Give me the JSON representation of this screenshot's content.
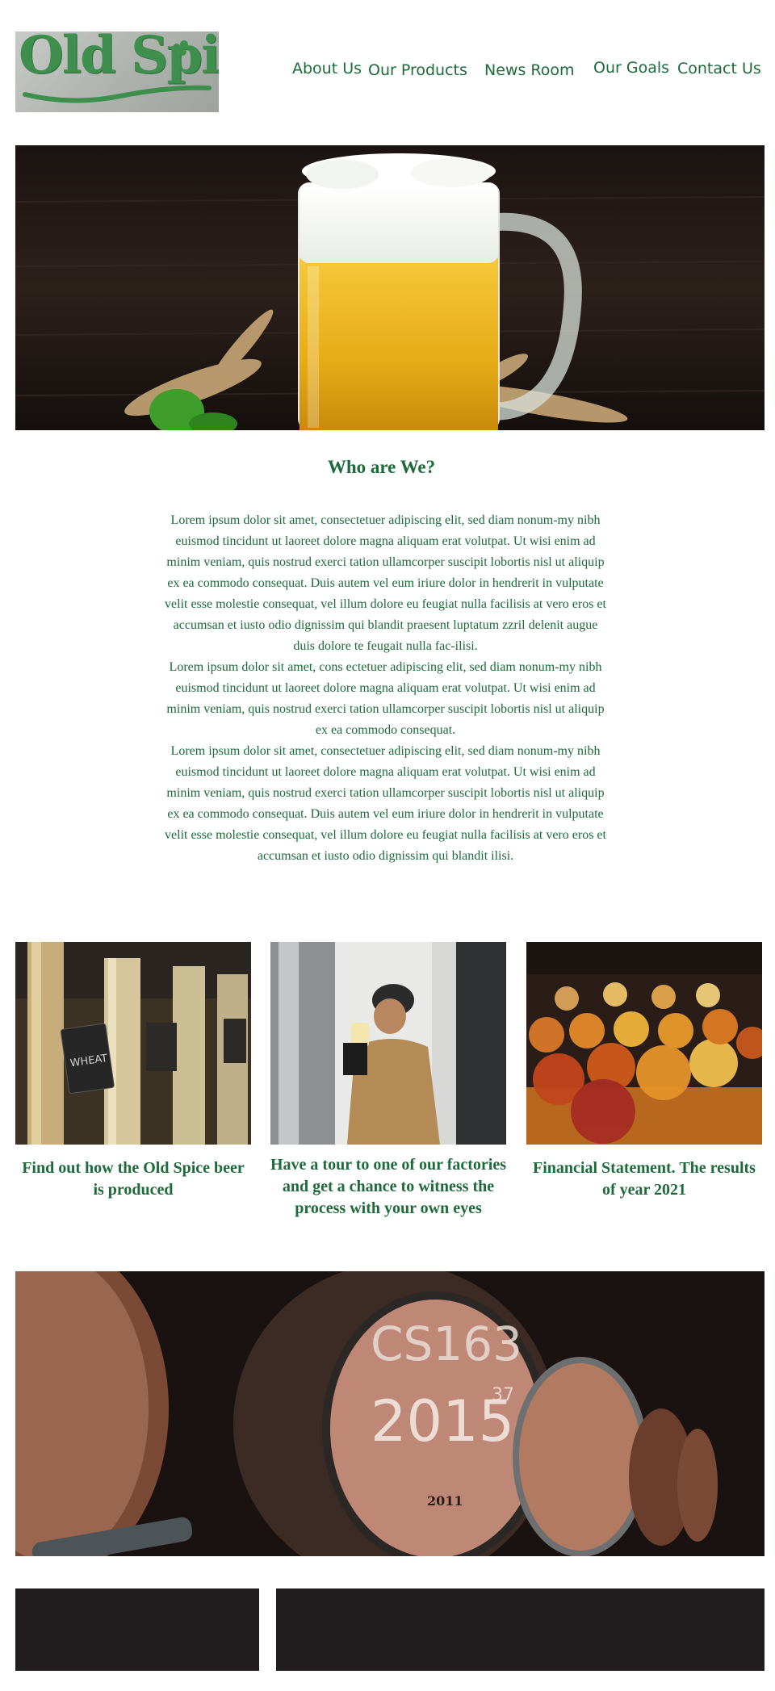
{
  "header": {
    "logo_text": "Old Spice",
    "nav": [
      {
        "label": "About Us"
      },
      {
        "label": "Our Products"
      },
      {
        "label": "News Room"
      },
      {
        "label": "Our Goals"
      },
      {
        "label": "Contact Us"
      }
    ]
  },
  "about": {
    "title": "Who are We?",
    "paragraphs": [
      "Lorem ipsum dolor sit amet, consectetuer adipiscing elit, sed diam nonum-my nibh euismod tincidunt ut laoreet dolore magna aliquam erat volutpat. Ut wisi enim ad minim veniam, quis nostrud exerci tation ullamcorper suscipit lobortis nisl ut aliquip ex ea commodo consequat. Duis autem vel eum iriure dolor in hendrerit in vulputate velit esse molestie consequat, vel illum dolore eu feugiat nulla facilisis at vero eros et accumsan et iusto odio dignissim qui blandit praesent luptatum zzril delenit augue duis dolore te feugait nulla fac-ilisi.",
      "Lorem ipsum dolor sit amet, cons ectetuer adipiscing elit, sed diam nonum-my nibh euismod tincidunt ut laoreet dolore magna aliquam erat volutpat. Ut wisi enim ad minim veniam, quis nostrud exerci tation ullamcorper suscipit lobortis nisl ut aliquip ex ea commodo consequat.",
      "Lorem ipsum dolor sit amet, consectetuer adipiscing elit, sed diam nonum-my nibh euismod tincidunt ut laoreet dolore magna aliquam erat volutpat. Ut wisi enim ad minim veniam, quis nostrud exerci tation ullamcorper suscipit lobortis nisl ut aliquip ex ea commodo consequat. Duis autem vel eum iriure dolor in hendrerit in vulputate velit esse molestie consequat, vel illum dolore eu feugiat nulla facilisis at vero eros et accumsan et iusto odio dignissim qui blandit ilisi."
    ]
  },
  "features": [
    {
      "caption": "Find out how the Old Spice beer is produced",
      "tap_sign": "WHEAT"
    },
    {
      "caption": "Have a tour to one of our factories and get a chance to witness the process with your own eyes"
    },
    {
      "caption": "Financial Statement. The results of year 2021"
    }
  ],
  "barrels": {
    "chalk_top": "CS163",
    "chalk_year": "2015",
    "chalk_sup": "37",
    "stamp": "2011"
  },
  "colors": {
    "brand_green": "#1d6a3a",
    "dark_box": "#221e1f"
  }
}
